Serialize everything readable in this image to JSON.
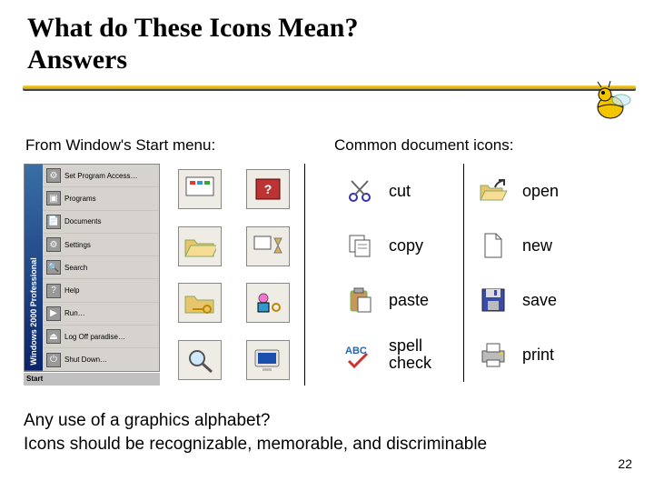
{
  "title_line1": "What do These Icons Mean?",
  "title_line2": "Answers",
  "subhead_left": "From Window's Start menu:",
  "subhead_right": "Common document icons:",
  "start_menu": {
    "banner": "Windows 2000 Professional",
    "items": [
      "Set Program Access…",
      "Programs",
      "Documents",
      "Settings",
      "Search",
      "Help",
      "Run…",
      "Log Off paradise…",
      "Shut Down…"
    ],
    "taskbar": "Start"
  },
  "doc_icons": {
    "col1": [
      {
        "name": "cut",
        "label": "cut"
      },
      {
        "name": "copy",
        "label": "copy"
      },
      {
        "name": "paste",
        "label": "paste"
      },
      {
        "name": "spellcheck",
        "label": "spell check"
      }
    ],
    "col2": [
      {
        "name": "open",
        "label": "open"
      },
      {
        "name": "new",
        "label": "new"
      },
      {
        "name": "save",
        "label": "save"
      },
      {
        "name": "print",
        "label": "print"
      }
    ]
  },
  "footer_line1": "Any use of a graphics alphabet?",
  "footer_line2": "Icons should be recognizable, memorable, and discriminable",
  "page_number": "22"
}
